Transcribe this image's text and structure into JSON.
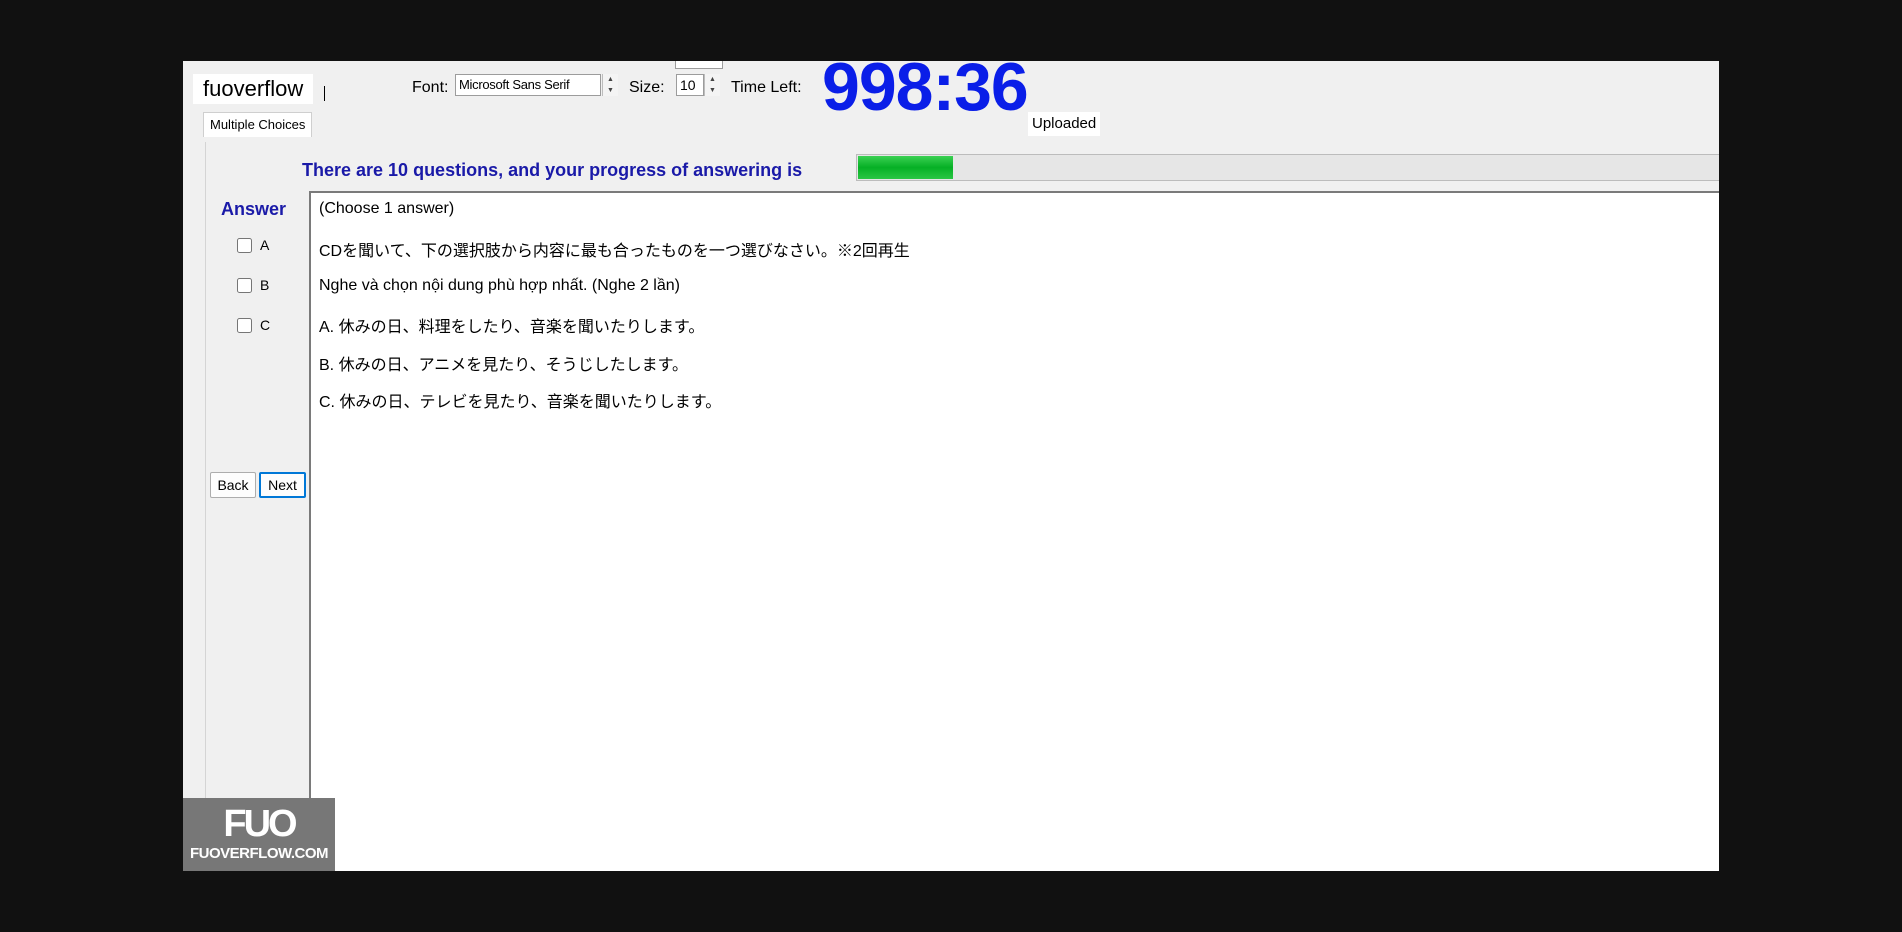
{
  "app": {
    "brand": "fuoverflow"
  },
  "toolbar": {
    "font_label": "Font:",
    "font_value": "Microsoft Sans Serif",
    "size_label": "Size:",
    "size_value": "10",
    "time_label": "Time Left:",
    "time_value": "998:36"
  },
  "tabs": {
    "multiple_choices": "Multiple Choices"
  },
  "status": {
    "uploaded": "Uploaded"
  },
  "progress": {
    "text": "There are 10 questions, and your progress of answering is",
    "fraction": 0.11,
    "color": "#06b025"
  },
  "answer": {
    "title": "Answer",
    "options": [
      "A",
      "B",
      "C"
    ]
  },
  "nav": {
    "back": "Back",
    "next": "Next"
  },
  "question": {
    "instruction": "(Choose 1 answer)",
    "prompt_jp": "CDを聞いて、下の選択肢から内容に最も合ったものを一つ選びなさい。※2回再生",
    "prompt_vi": "Nghe và chọn nội dung phù hợp nhất.  (Nghe 2 lần)",
    "choices": [
      "A.  休みの日、料理をしたり、音楽を聞いたりします。",
      "B.  休みの日、アニメを見たり、そうじしたします。",
      "C.  休みの日、テレビを見たり、音楽を聞いたりします。"
    ]
  },
  "watermark": {
    "mark": "FUO",
    "site": "FUOVERFLOW.COM"
  },
  "colors": {
    "timer": "#0a1ee8",
    "heading": "#1a1aa8",
    "focus": "#0078d7"
  }
}
